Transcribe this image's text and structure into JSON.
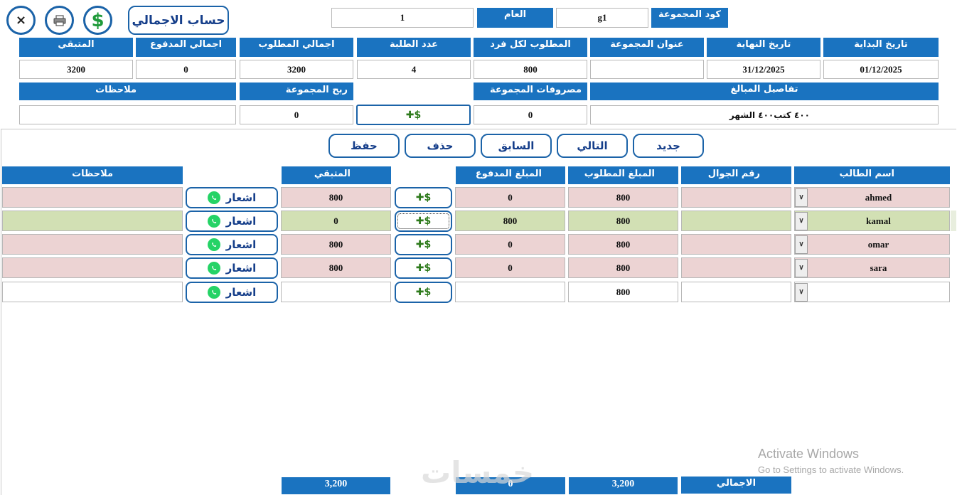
{
  "toolbar": {
    "close_glyph": "×",
    "title_button": "حساب الاجمالي"
  },
  "group_bar": {
    "code_label": "كود المجموعة",
    "code_value": "g1",
    "year_label": "العام",
    "year_value": "1"
  },
  "summary_headers": {
    "start_date": "تاريخ البداية",
    "end_date": "تاريخ النهاية",
    "group_title": "عنوان المجموعة",
    "required_per_person": "المطلوب لكل فرد",
    "student_count": "عدد الطلبة",
    "total_required": "اجمالي المطلوب",
    "total_paid": "اجمالي المدفوع",
    "remaining": "المتبقي"
  },
  "summary_values": {
    "start_date": "01/12/2025",
    "end_date": "31/12/2025",
    "group_title": "",
    "required_per_person": "800",
    "student_count": "4",
    "total_required": "3200",
    "total_paid": "0",
    "remaining": "3200"
  },
  "details": {
    "amount_details_label": "تفاصيل المبالغ",
    "amount_details_value": "٤٠٠ كتب٤٠٠ الشهر",
    "group_expenses_label": "مصروفات المجموعة",
    "group_expenses_value": "0",
    "group_profit_label": "ربح المجموعة",
    "group_profit_value": "0",
    "notes_label": "ملاحظات",
    "notes_value": ""
  },
  "nav_buttons": {
    "new": "جديد",
    "next": "التالي",
    "previous": "السابق",
    "delete": "حذف",
    "save": "حفظ"
  },
  "table": {
    "headers": {
      "student_name": "اسم الطالب",
      "mobile": "رقم الجوال",
      "required": "المبلغ المطلوب",
      "paid": "المبلغ المدفوع",
      "remaining": "المتبقي",
      "notes": "ملاحظات"
    },
    "notify_label": "اشعار",
    "rows": [
      {
        "name": "ahmed",
        "mobile": "",
        "required": "800",
        "paid": "0",
        "remaining": "800",
        "notes": "",
        "status": "unpaid"
      },
      {
        "name": "kamal",
        "mobile": "",
        "required": "800",
        "paid": "800",
        "remaining": "0",
        "notes": "",
        "status": "paid"
      },
      {
        "name": "omar",
        "mobile": "",
        "required": "800",
        "paid": "0",
        "remaining": "800",
        "notes": "",
        "status": "unpaid"
      },
      {
        "name": "sara",
        "mobile": "",
        "required": "800",
        "paid": "0",
        "remaining": "800",
        "notes": "",
        "status": "unpaid"
      },
      {
        "name": "",
        "mobile": "",
        "required": "800",
        "paid": "",
        "remaining": "",
        "notes": "",
        "status": "new"
      }
    ]
  },
  "totals": {
    "label": "الاجمالي",
    "required": "3,200",
    "paid": "0",
    "remaining": "3,200"
  },
  "overlay": {
    "activate_title": "Activate Windows",
    "activate_sub": "Go to Settings to activate Windows.",
    "watermark": "خمسات"
  },
  "colors": {
    "header_blue": "#1a73c0",
    "unpaid_row": "#ecd3d3",
    "paid_row": "#d2e0b4",
    "button_border": "#1b63a8"
  }
}
